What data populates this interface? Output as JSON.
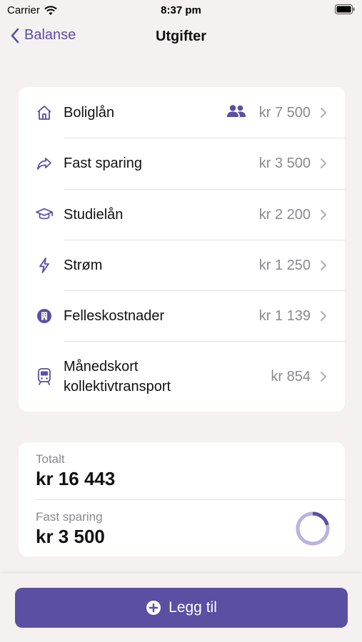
{
  "status_bar": {
    "carrier": "Carrier",
    "time": "8:37 pm"
  },
  "nav": {
    "back_label": "Balanse",
    "title": "Utgifter"
  },
  "expenses": [
    {
      "icon": "house-icon",
      "label": "Boliglån",
      "amount": "kr 7 500",
      "shared": true
    },
    {
      "icon": "share-arrow-icon",
      "label": "Fast sparing",
      "amount": "kr 3 500",
      "shared": false
    },
    {
      "icon": "graduation-cap-icon",
      "label": "Studielån",
      "amount": "kr 2 200",
      "shared": false
    },
    {
      "icon": "lightning-icon",
      "label": "Strøm",
      "amount": "kr 1 250",
      "shared": false
    },
    {
      "icon": "building-icon",
      "label": "Felleskostnader",
      "amount": "kr 1 139",
      "shared": false
    },
    {
      "icon": "train-icon",
      "label_line1": "Månedskort",
      "label_line2": "kollektivtransport",
      "amount": "kr 854",
      "shared": false
    }
  ],
  "summary": {
    "total_label": "Totalt",
    "total_value": "kr 16 443",
    "savings_label": "Fast sparing",
    "savings_value": "kr 3 500",
    "savings_fraction": 0.21
  },
  "add_button": {
    "label": "Legg til"
  },
  "colors": {
    "accent": "#5a4fa3",
    "background": "#f5f1f0",
    "ring_track": "#b9b3dc"
  }
}
